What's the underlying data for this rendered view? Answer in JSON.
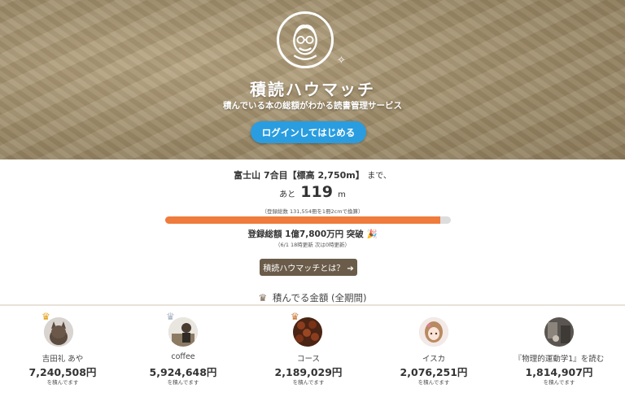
{
  "hero": {
    "app_name": "積読ハウマッチ",
    "tagline": "積んでいる本の総額がわかる読書管理サービス",
    "login_label": "ログインしてはじめる"
  },
  "progress": {
    "milestone": "富士山 7合目【標高 2,750m】",
    "milestone_suffix": "まで、",
    "remaining_prefix": "あと",
    "remaining_value": "119",
    "remaining_unit": "m",
    "conversion_note": "（登録総数 131,554冊を1冊2cmで換算）",
    "percent": 96.2,
    "total": "登録総額 1億7,800万円 突破",
    "updated": "（6/1 18時更新 次は0時更新）",
    "about_label": "積読ハウマッチとは？"
  },
  "ranking": {
    "heading": "積んでる金額 (全期間)",
    "items": [
      {
        "name": "吉田礼 あや",
        "amount": "7,240,508円",
        "suffix": "を積んでます",
        "crown": "gold"
      },
      {
        "name": "coffee",
        "amount": "5,924,648円",
        "suffix": "を積んでます",
        "crown": "silver"
      },
      {
        "name": "コース",
        "amount": "2,189,029円",
        "suffix": "を積んでます",
        "crown": "bronze"
      },
      {
        "name": "イスカ",
        "amount": "2,076,251円",
        "suffix": "を積んでます",
        "crown": ""
      },
      {
        "name": "『物理的運動学1』を読む",
        "amount": "1,814,907円",
        "suffix": "を積んでます",
        "crown": ""
      }
    ]
  },
  "colors": {
    "accent_blue": "#2a9de0",
    "progress_orange": "#ef7b3c",
    "about_brown": "#6b5c4a"
  }
}
